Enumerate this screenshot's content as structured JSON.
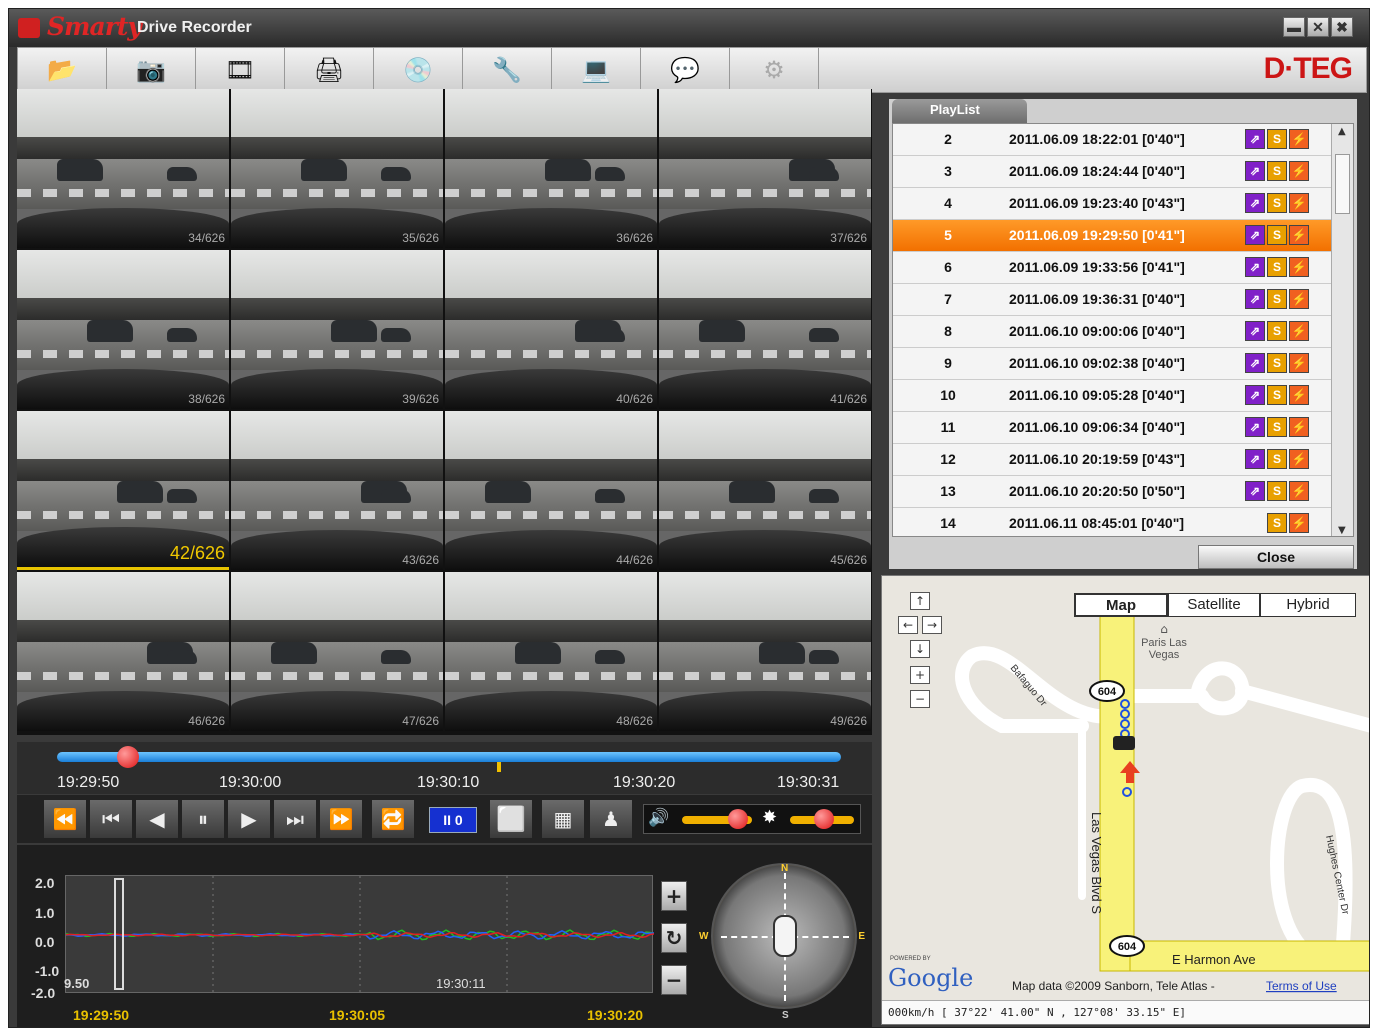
{
  "window": {
    "logo": "Smarty",
    "title": "Drive Recorder",
    "brand": "D·TEG"
  },
  "toolbar": [
    "folder-open-icon",
    "capture-icon",
    "save-clip-icon",
    "print-icon",
    "disc-icon",
    "wrench-icon",
    "monitor-icon",
    "speech-bubble-icon",
    "gear-disabled-icon"
  ],
  "thumbnails": [
    "34/626",
    "35/626",
    "36/626",
    "37/626",
    "38/626",
    "39/626",
    "40/626",
    "41/626",
    "42/626",
    "43/626",
    "44/626",
    "45/626",
    "46/626",
    "47/626",
    "48/626",
    "49/626"
  ],
  "active_frame": "42/626",
  "progress_fraction": 0.09,
  "timeline_labels": [
    "19:29:50",
    "19:30:00",
    "19:30:10",
    "19:30:20",
    "19:30:31"
  ],
  "controls": {
    "speed": "II 0"
  },
  "gsensor": {
    "y_labels": [
      "2.0",
      "1.0",
      "0.0",
      "-1.0",
      "-2.0"
    ],
    "left_value": "9.50",
    "cursor_time": "19:30:11",
    "x_labels": [
      "19:29:50",
      "19:30:05",
      "19:30:20"
    ],
    "compass": {
      "n": "N",
      "e": "E",
      "s": "S",
      "w": "W"
    },
    "series_colors": {
      "x": "#e02020",
      "y": "#20c020",
      "z": "#2060ff"
    }
  },
  "playlist": {
    "tab": "PlayList",
    "close": "Close",
    "rows": [
      {
        "n": "2",
        "d": "2011.06.09 18:22:01 [0'40\"]"
      },
      {
        "n": "3",
        "d": "2011.06.09 18:24:44 [0'40\"]"
      },
      {
        "n": "4",
        "d": "2011.06.09 19:23:40 [0'43\"]"
      },
      {
        "n": "5",
        "d": "2011.06.09 19:29:50 [0'41\"]",
        "sel": true
      },
      {
        "n": "6",
        "d": "2011.06.09 19:33:56 [0'41\"]"
      },
      {
        "n": "7",
        "d": "2011.06.09 19:36:31 [0'40\"]"
      },
      {
        "n": "8",
        "d": "2011.06.10 09:00:06 [0'40\"]"
      },
      {
        "n": "9",
        "d": "2011.06.10 09:02:38 [0'40\"]"
      },
      {
        "n": "10",
        "d": "2011.06.10 09:05:28 [0'40\"]"
      },
      {
        "n": "11",
        "d": "2011.06.10 09:06:34 [0'40\"]"
      },
      {
        "n": "12",
        "d": "2011.06.10 20:19:59 [0'43\"]"
      },
      {
        "n": "13",
        "d": "2011.06.10 20:20:50 [0'50\"]"
      },
      {
        "n": "14",
        "d": "2011.06.11 08:45:01 [0'40\"]",
        "two": true
      }
    ]
  },
  "map": {
    "types": [
      "Map",
      "Satellite",
      "Hybrid"
    ],
    "poi": [
      "Paris Las",
      "Vegas"
    ],
    "roads": {
      "bafaguo": "Bafaguo Dr",
      "lv_blvd": "Las Vegas Blvd S",
      "harmon": "E Harmon Ave",
      "hughes": "Hughes Center Dr",
      "route": "604"
    },
    "google": "Google",
    "powered": "POWERED BY",
    "copyright": "Map data ©2009 Sanborn, Tele Atlas - ",
    "terms": "Terms of Use",
    "status": "000km/h  [ 37°22' 41.00\" N , 127°08' 33.15\" E]"
  }
}
